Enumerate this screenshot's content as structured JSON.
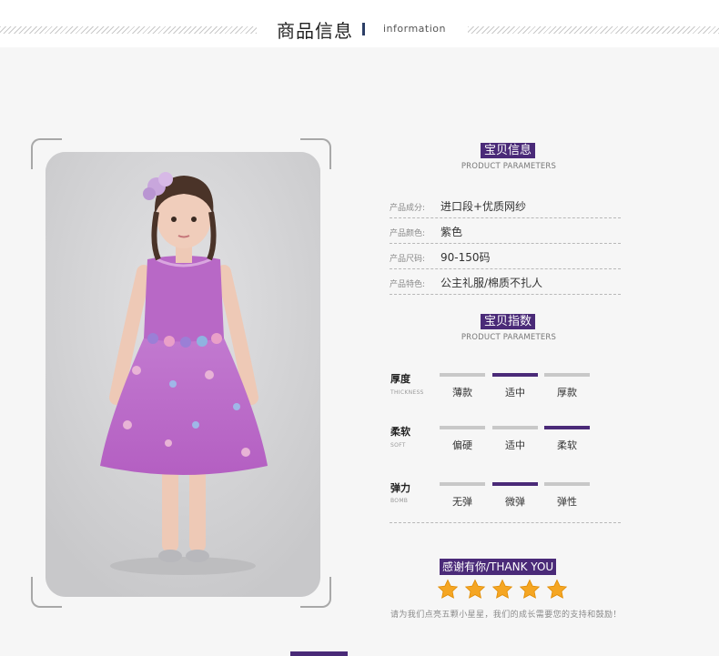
{
  "header": {
    "title": "商品信息",
    "subtitle": "information"
  },
  "colors": {
    "accent": "#4a2a78",
    "inactive_bar": "#c8c8c8",
    "star": "#f5a623"
  },
  "product_photo": {
    "icon": "product-photo",
    "description_name": "girl-purple-dress-photo"
  },
  "info_section": {
    "title": "宝贝信息",
    "subtitle": "PRODUCT PARAMETERS",
    "rows": [
      {
        "key": "产品成分:",
        "value": "进口段+优质网纱"
      },
      {
        "key": "产品颜色:",
        "value": "紫色"
      },
      {
        "key": "产品尺码:",
        "value": "90-150码"
      },
      {
        "key": "产品特色:",
        "value": "公主礼服/棉质不扎人"
      }
    ]
  },
  "index_section": {
    "title": "宝贝指数",
    "subtitle": "PRODUCT PARAMETERS",
    "rows": [
      {
        "name": "厚度",
        "en": "THICKNESS",
        "options": [
          "薄款",
          "适中",
          "厚款"
        ],
        "selected": 1
      },
      {
        "name": "柔软",
        "en": "SOFT",
        "options": [
          "偏硬",
          "适中",
          "柔软"
        ],
        "selected": 2
      },
      {
        "name": "弹力",
        "en": "BOMB",
        "options": [
          "无弹",
          "微弹",
          "弹性"
        ],
        "selected": 1
      }
    ]
  },
  "thanks": {
    "title": "感谢有你/THANK YOU",
    "star_rating": 5,
    "note": "请为我们点亮五颗小星星，我们的成长需要您的支持和鼓励！"
  }
}
